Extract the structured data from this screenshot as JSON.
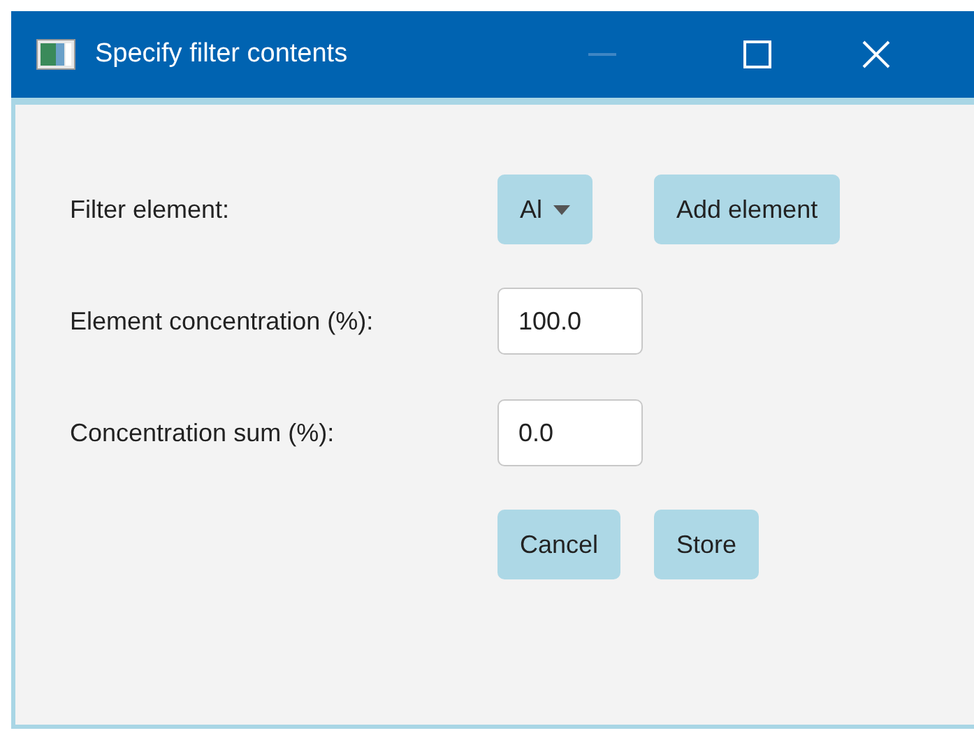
{
  "window": {
    "title": "Specify filter contents",
    "minimize_disabled": true
  },
  "form": [
    {
      "label": "Filter element:",
      "kind": "dropdown",
      "value": "Al",
      "button": "Add element"
    },
    {
      "label": "Element concentration (%):",
      "kind": "input",
      "value": "100.0"
    },
    {
      "label": "Concentration sum (%):",
      "kind": "input",
      "value": "0.0"
    }
  ],
  "buttons": [
    "Cancel",
    "Store"
  ]
}
